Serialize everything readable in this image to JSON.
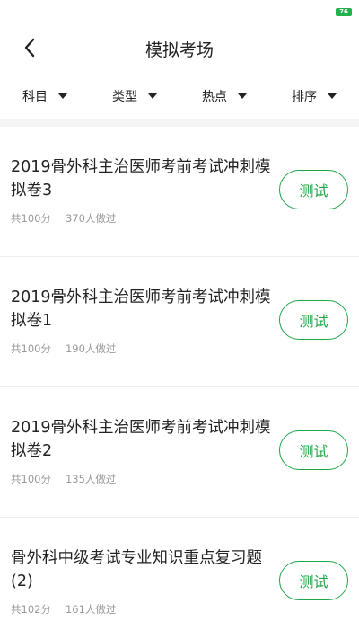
{
  "status_bar": {
    "battery": "76"
  },
  "header": {
    "title": "模拟考场"
  },
  "filters": [
    {
      "label": "科目"
    },
    {
      "label": "类型"
    },
    {
      "label": "热点"
    },
    {
      "label": "排序"
    }
  ],
  "exams": [
    {
      "title": "2019骨外科主治医师考前考试冲刺模拟卷3",
      "score": "共100分",
      "taken": "370人做过",
      "button": "测试"
    },
    {
      "title": "2019骨外科主治医师考前考试冲刺模拟卷1",
      "score": "共100分",
      "taken": "190人做过",
      "button": "测试"
    },
    {
      "title": "2019骨外科主治医师考前考试冲刺模拟卷2",
      "score": "共100分",
      "taken": "135人做过",
      "button": "测试"
    },
    {
      "title": "骨外科中级考试专业知识重点复习题(2)",
      "score": "共102分",
      "taken": "161人做过",
      "button": "测试"
    }
  ],
  "colors": {
    "accent": "#1fa64a",
    "meta_text": "#9a9a9a",
    "battery": "#22b14c"
  }
}
